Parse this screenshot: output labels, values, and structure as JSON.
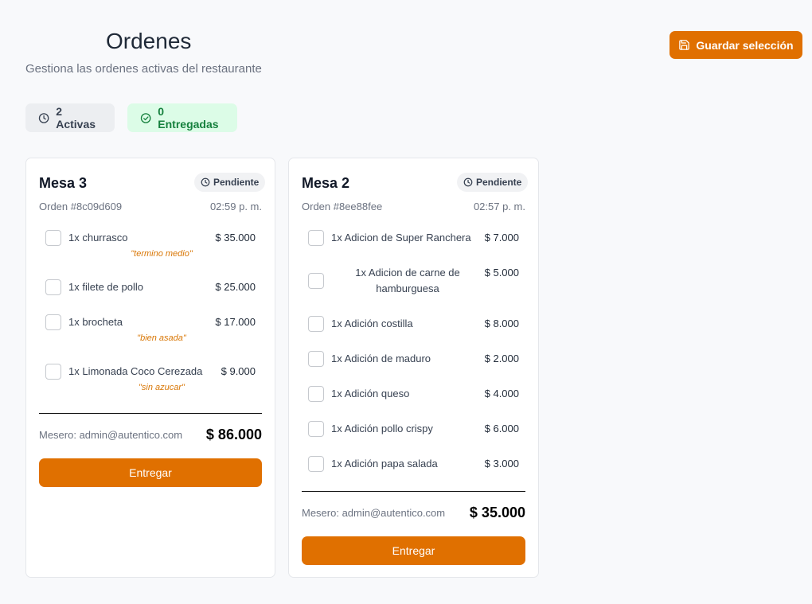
{
  "header": {
    "title": "Ordenes",
    "subtitle": "Gestiona las ordenes activas del restaurante",
    "save_label": "Guardar selección"
  },
  "badges": {
    "active": "2 Activas",
    "delivered": "0 Entregadas"
  },
  "colors": {
    "accent": "#e07000",
    "note": "#d97706",
    "delivered_bg": "#dcfce7",
    "delivered_text": "#15803d"
  },
  "orders": [
    {
      "table": "Mesa 3",
      "status": "Pendiente",
      "order_id": "Orden #8c09d609",
      "time": "02:59 p. m.",
      "items": [
        {
          "name": "1x churrasco",
          "price": "$ 35.000",
          "note": "\"termino medio\""
        },
        {
          "name": "1x filete de pollo",
          "price": "$ 25.000"
        },
        {
          "name": "1x brocheta",
          "price": "$ 17.000",
          "note": "\"bien asada\""
        },
        {
          "name": "1x Limonada Coco Cerezada",
          "price": "$ 9.000",
          "note": "\"sin azucar\""
        }
      ],
      "waiter": "Mesero: admin@autentico.com",
      "total": "$ 86.000",
      "deliver_label": "Entregar"
    },
    {
      "table": "Mesa 2",
      "status": "Pendiente",
      "order_id": "Orden #8ee88fee",
      "time": "02:57 p. m.",
      "items": [
        {
          "name": "1x Adicion de Super Ranchera",
          "price": "$ 7.000"
        },
        {
          "name": "1x Adicion de carne de hamburguesa",
          "price": "$ 5.000"
        },
        {
          "name": "1x Adición costilla",
          "price": "$ 8.000"
        },
        {
          "name": "1x Adición de maduro",
          "price": "$ 2.000"
        },
        {
          "name": "1x Adición queso",
          "price": "$ 4.000"
        },
        {
          "name": "1x Adición pollo crispy",
          "price": "$ 6.000"
        },
        {
          "name": "1x Adición papa salada",
          "price": "$ 3.000"
        }
      ],
      "waiter": "Mesero: admin@autentico.com",
      "total": "$ 35.000",
      "deliver_label": "Entregar"
    }
  ]
}
